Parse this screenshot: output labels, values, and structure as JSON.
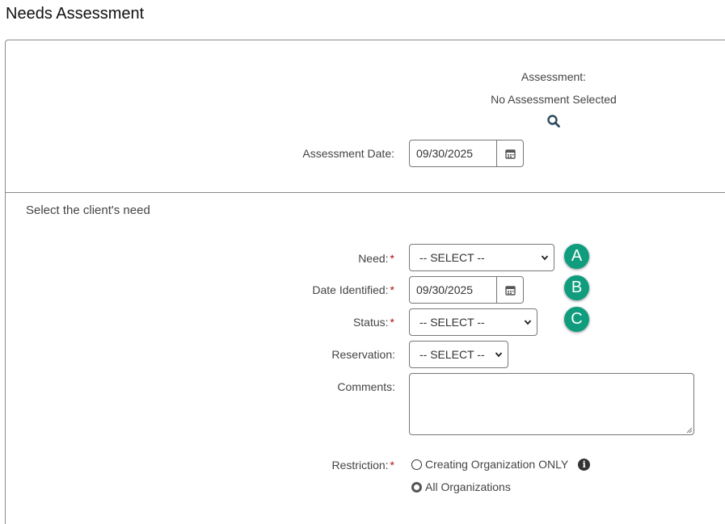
{
  "page": {
    "title": "Needs Assessment"
  },
  "assessment": {
    "label": "Assessment:",
    "value": "No Assessment Selected",
    "search_icon": "search-icon",
    "date_label": "Assessment Date:",
    "date_value": "09/30/2025"
  },
  "need_section": {
    "heading": "Select the client's need",
    "need_label": "Need:",
    "need_value": "-- SELECT --",
    "date_identified_label": "Date Identified:",
    "date_identified_value": "09/30/2025",
    "status_label": "Status:",
    "status_value": "-- SELECT --",
    "reservation_label": "Reservation:",
    "reservation_value": "-- SELECT --",
    "comments_label": "Comments:",
    "comments_value": "",
    "restriction_label": "Restriction:",
    "restriction_options": [
      {
        "label": "Creating Organization ONLY",
        "checked": false
      },
      {
        "label": "All Organizations",
        "checked": true
      }
    ],
    "required_marker": "*"
  },
  "callouts": [
    "A",
    "B",
    "C"
  ],
  "colors": {
    "callout": "#109d7d",
    "required": "#b01010",
    "border": "#777777"
  }
}
